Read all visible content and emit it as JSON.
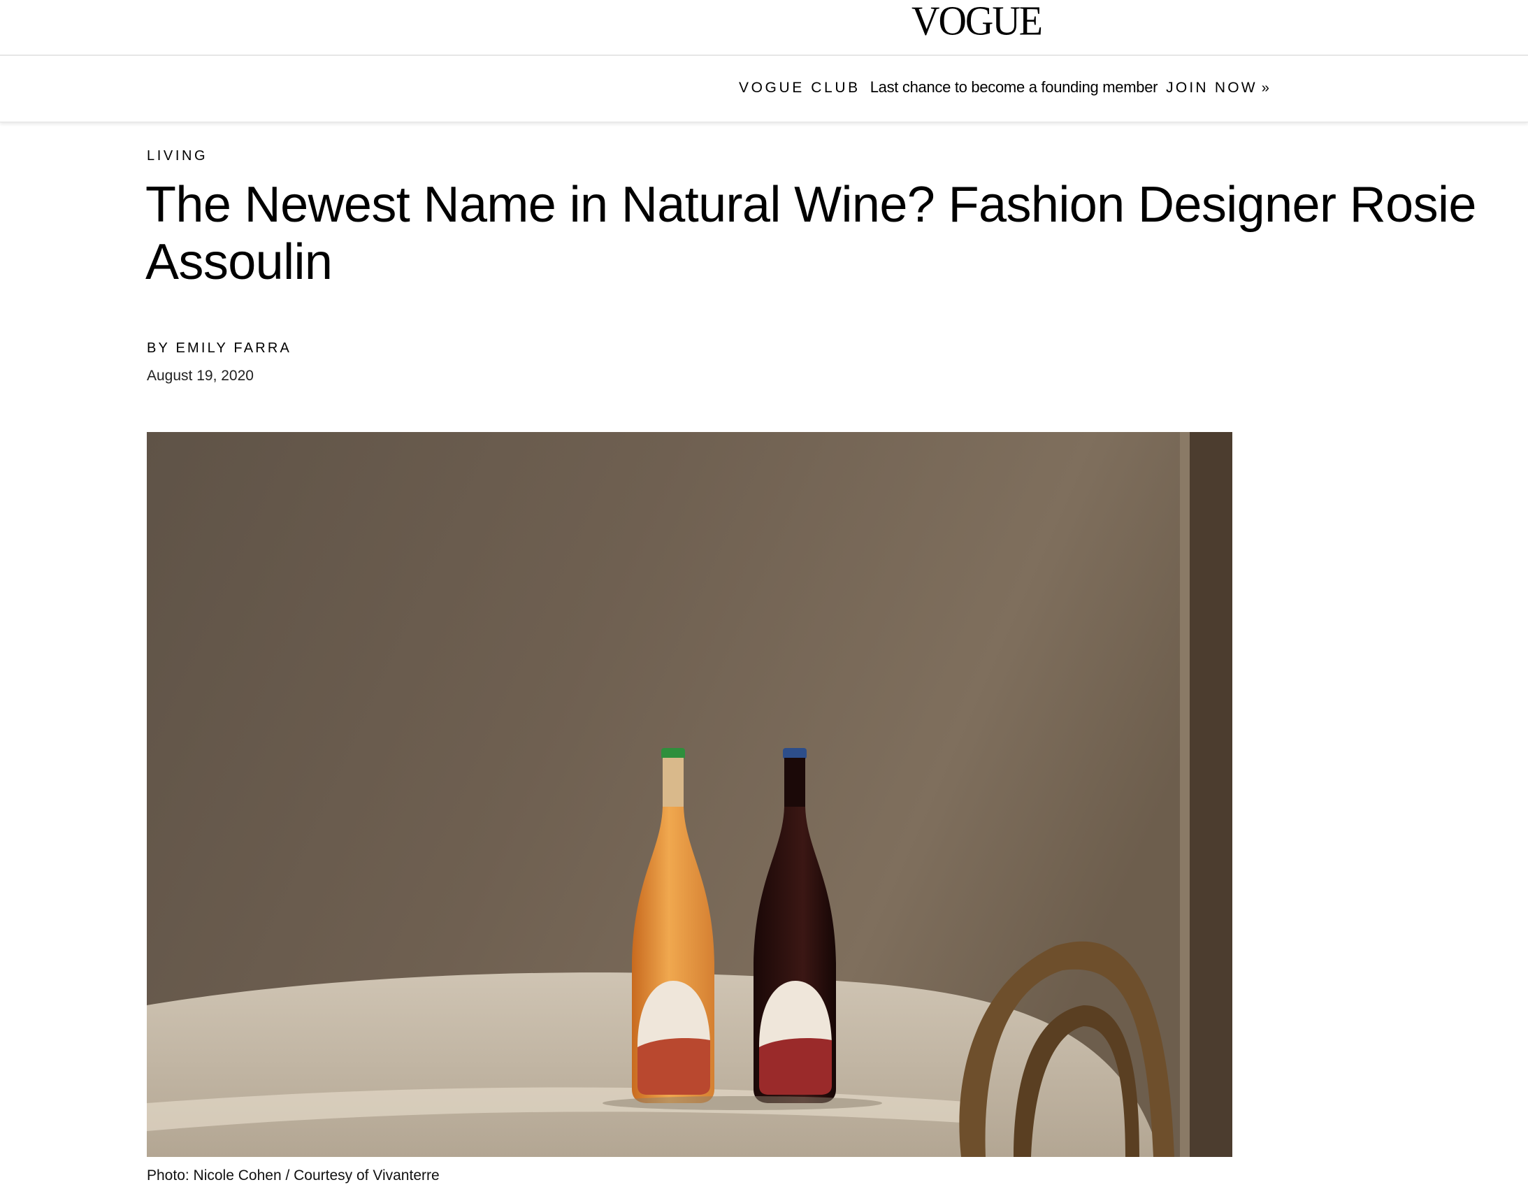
{
  "header": {
    "logo": "VOGUE"
  },
  "promo": {
    "club_label": "VOGUE CLUB",
    "message": "Last chance to become a founding member",
    "cta_label": "JOIN NOW",
    "cta_arrow": "»"
  },
  "article": {
    "rubric": "LIVING",
    "headline": "The Newest Name in Natural Wine? Fashion Designer Rosie Assoulin",
    "byline_prefix": "BY",
    "author": "EMILY FARRA",
    "date": "August 19, 2020",
    "photo_caption": "Photo: Nicole Cohen / Courtesy of Vivanterre"
  },
  "colors": {
    "wall": "#7a6b59",
    "tablecloth": "#dcd2c2",
    "orange_wine": "#e0913a",
    "red_wine": "#2a0f0f",
    "label_red": "#b94a33"
  }
}
